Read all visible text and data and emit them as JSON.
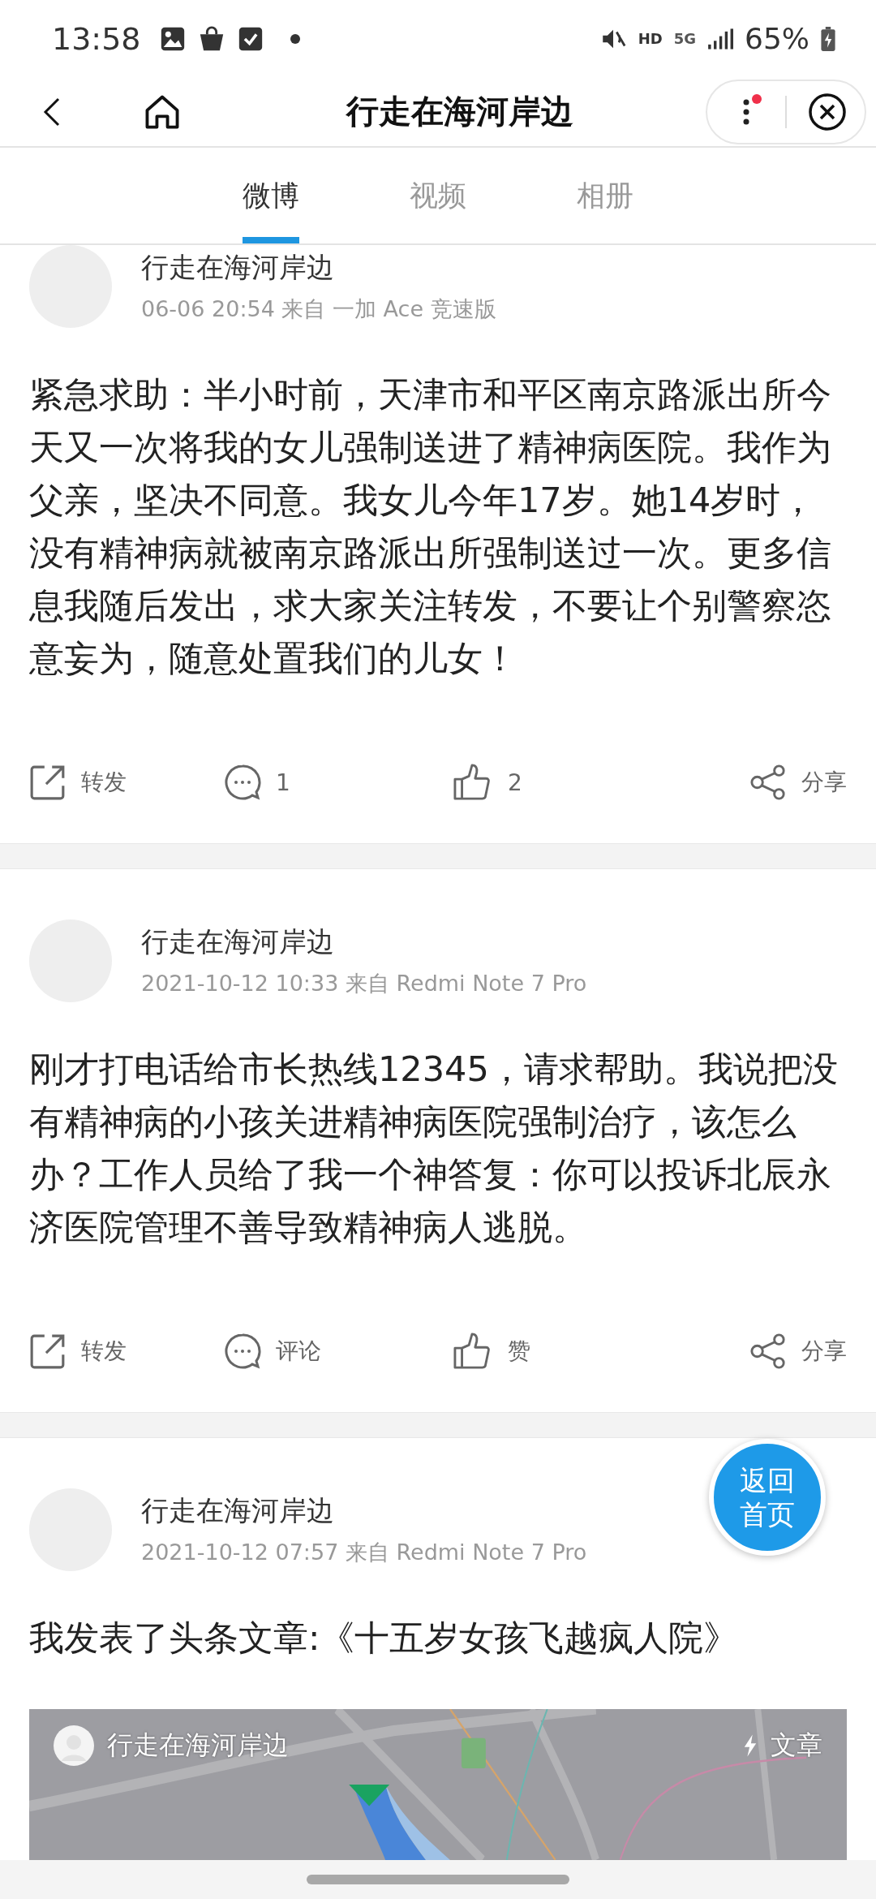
{
  "status_bar": {
    "time": "13:58",
    "hd": "HD",
    "network": "5G",
    "battery": "65%"
  },
  "header": {
    "title": "行走在海河岸边",
    "menu_badge": true
  },
  "tabs": [
    {
      "label": "微博",
      "selected": true
    },
    {
      "label": "视频",
      "selected": false
    },
    {
      "label": "相册",
      "selected": false
    }
  ],
  "posts": [
    {
      "author": "行走在海河岸边",
      "meta": "06-06 20:54 来自 一加 Ace 竞速版",
      "text": "紧急求助：半小时前，天津市和平区南京路派出所今天又一次将我的女儿强制送进了精神病医院。我作为父亲，坚决不同意。我女儿今年17岁。她14岁时，没有精神病就被南京路派出所强制送过一次。更多信息我随后发出，求大家关注转发，不要让个别警察恣意妄为，随意处置我们的儿女！",
      "actions": [
        {
          "kind": "repost",
          "label": "转发"
        },
        {
          "kind": "comment",
          "label": "1"
        },
        {
          "kind": "like",
          "label": "2"
        },
        {
          "kind": "share",
          "label": "分享"
        }
      ]
    },
    {
      "author": "行走在海河岸边",
      "meta": "2021-10-12 10:33 来自 Redmi Note 7 Pro",
      "text": "刚才打电话给市长热线12345，请求帮助。我说把没有精神病的小孩关进精神病医院强制治疗，该怎么办？工作人员给了我一个神答复：你可以投诉北辰永济医院管理不善导致精神病人逃脱。",
      "actions": [
        {
          "kind": "repost",
          "label": "转发"
        },
        {
          "kind": "comment",
          "label": "评论"
        },
        {
          "kind": "like",
          "label": "赞"
        },
        {
          "kind": "share",
          "label": "分享"
        }
      ]
    },
    {
      "author": "行走在海河岸边",
      "meta": "2021-10-12 07:57 来自 Redmi Note 7 Pro",
      "text": "我发表了头条文章:《十五岁女孩飞越疯人院》",
      "article": {
        "author": "行走在海河岸边",
        "tag": "文章",
        "kind": "picture"
      }
    }
  ],
  "float_button": {
    "lines": [
      "返回",
      "首页"
    ]
  }
}
